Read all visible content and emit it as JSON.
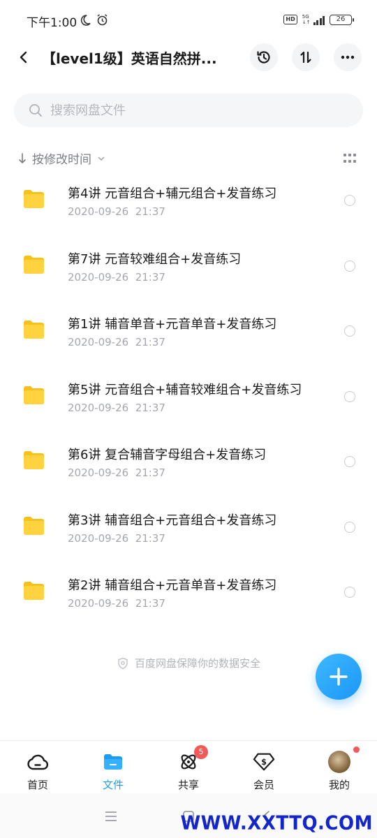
{
  "status_bar": {
    "time": "下午1:00",
    "battery": "26",
    "network": "5G",
    "hd": "HD"
  },
  "header": {
    "title": "【level1级】英语自然拼..."
  },
  "search": {
    "placeholder": "搜索网盘文件"
  },
  "sort": {
    "label": "按修改时间"
  },
  "files": [
    {
      "name": "第4讲 元音组合+辅元组合+发音练习",
      "date": "2020-09-26  21:37"
    },
    {
      "name": "第7讲 元音较难组合+发音练习",
      "date": "2020-09-26  21:37"
    },
    {
      "name": "第1讲 辅音单音+元音单音+发音练习",
      "date": "2020-09-26  21:37"
    },
    {
      "name": "第5讲 元音组合+辅音较难组合+发音练习",
      "date": "2020-09-26  21:37"
    },
    {
      "name": "第6讲 复合辅音字母组合+发音练习",
      "date": "2020-09-26  21:37"
    },
    {
      "name": "第3讲 辅音组合+元音组合+发音练习",
      "date": "2020-09-26  21:37"
    },
    {
      "name": "第2讲 辅音组合+元音单音+发音练习",
      "date": "2020-09-26  21:37"
    }
  ],
  "footer_note": "百度网盘保障你的数据安全",
  "bottom_nav": {
    "home": "首页",
    "files": "文件",
    "share": "共享",
    "share_badge": "5",
    "vip": "会员",
    "me": "我的"
  },
  "watermark": "WWW.XXTTQ.COM",
  "colors": {
    "accent": "#1d9cf5",
    "folder": "#ffd23f",
    "badge": "#f25a5a"
  }
}
